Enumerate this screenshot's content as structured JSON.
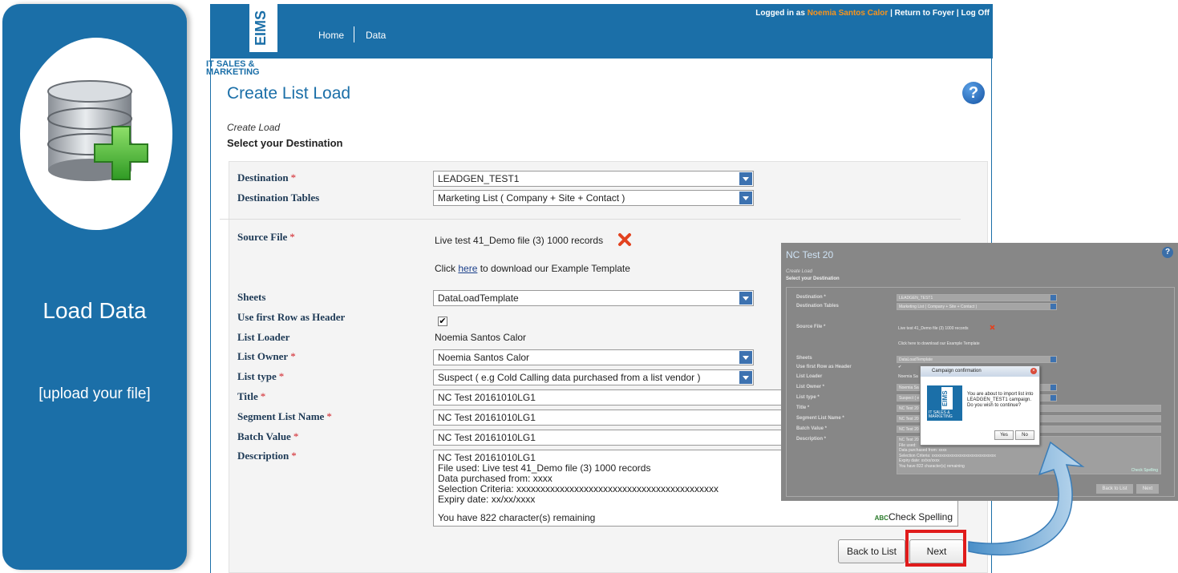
{
  "promo": {
    "title": "Load Data",
    "subtitle": "[upload your file]"
  },
  "header": {
    "logo_text": "EIMS",
    "brand_line1": "IT SALES &",
    "brand_line2": "MARKETING",
    "nav": {
      "home": "Home",
      "data": "Data"
    },
    "login_prefix": "Logged in as ",
    "user_name": "Noemia Santos Calor",
    "login_suffix": " | Return to Foyer | Log Off"
  },
  "page": {
    "title": "Create List Load",
    "breadcrumb": "Create Load",
    "step": "Select your Destination",
    "help": "?"
  },
  "form": {
    "required_mark": "*",
    "destination": {
      "label": "Destination",
      "value": "LEADGEN_TEST1"
    },
    "destination_tables": {
      "label": "Destination Tables",
      "value": "Marketing List ( Company +  Site + Contact )"
    },
    "source_file": {
      "label": "Source File",
      "value": "Live test 41_Demo file (3) 1000 records"
    },
    "template": {
      "prefix": "Click ",
      "link": "here",
      "suffix": " to download our Example Template"
    },
    "sheets": {
      "label": "Sheets",
      "value": "DataLoadTemplate"
    },
    "first_row_header": {
      "label": "Use first Row as Header",
      "checked": "✔"
    },
    "list_loader": {
      "label": "List Loader",
      "value": "Noemia Santos Calor"
    },
    "list_owner": {
      "label": "List Owner",
      "value": "Noemia Santos Calor"
    },
    "list_type": {
      "label": "List type",
      "value": "Suspect ( e.g Cold Calling data purchased from a list vendor )"
    },
    "title": {
      "label": "Title",
      "value": "NC Test 20161010LG1"
    },
    "segment_list_name": {
      "label": "Segment List Name",
      "value": "NC Test 20161010LG1"
    },
    "batch_value": {
      "label": "Batch Value",
      "value": "NC Test 20161010LG1"
    },
    "description": {
      "label": "Description",
      "lines": [
        "NC Test 20161010LG1",
        "File used: Live test 41_Demo file (3) 1000 records",
        "Data purchased from: xxxx",
        "Selection Criteria: xxxxxxxxxxxxxxxxxxxxxxxxxxxxxxxxxxxxxxxxxx",
        "Expiry date: xx/xx/xxxx"
      ],
      "remaining": "You have 822 character(s) remaining",
      "spell_abc": "ABC",
      "spell_check": "Check Spelling"
    },
    "buttons": {
      "back": "Back to List",
      "next": "Next"
    }
  },
  "thumbnail": {
    "title": "NC Test 20",
    "help": "?",
    "breadcrumb": "Create Load",
    "step": "Select your Destination",
    "labels": [
      "Destination *",
      "Destination Tables",
      "Source File *",
      "Sheets",
      "Use first Row as Header",
      "List Loader",
      "List Owner *",
      "List type *",
      "Title *",
      "Segment List Name *",
      "Batch Value *",
      "Description *"
    ],
    "destination": "LEADGEN_TEST1",
    "destination_tables": "Marketing List ( Company +  Site + Contact )",
    "source_file": "Live test 41_Demo file (3) 1000 records",
    "template_text": "Click here to download our Example Template",
    "sheets": "DataLoadTemplate",
    "checked": "✔",
    "list_loader": "Noemia Sa",
    "list_owner": "Noemia Sa",
    "list_type": "Suspect ( e",
    "segment": "NC Test 20",
    "batch": "NC Test 20",
    "desc_lines": [
      "NC Test 20",
      "File used:",
      "Data purchased from: xxxx",
      "Selection Criteria: xxxxxxxxxxxxxxxxxxxxxxxxxxxxxxxx",
      "Expiry date: xx/xx/xxxx",
      "You have 822 character(s) remaining"
    ],
    "spell": "Check Spelling",
    "back": "Back to List",
    "next": "Next"
  },
  "dialog": {
    "title": "Campaign confirmation",
    "close": "×",
    "logo_text": "EIMS",
    "logo_sub1": "IT SALES &",
    "logo_sub2": "MARKETING",
    "message": "You are about to import list into LEADGEN_TEST1 campaign. Do you wish to continue?",
    "yes": "Yes",
    "no": "No"
  },
  "colors": {
    "brand_blue": "#1b6fa8",
    "accent_orange": "#f7941d",
    "required_red": "#d2232a",
    "highlight_red": "#e01b1b"
  }
}
